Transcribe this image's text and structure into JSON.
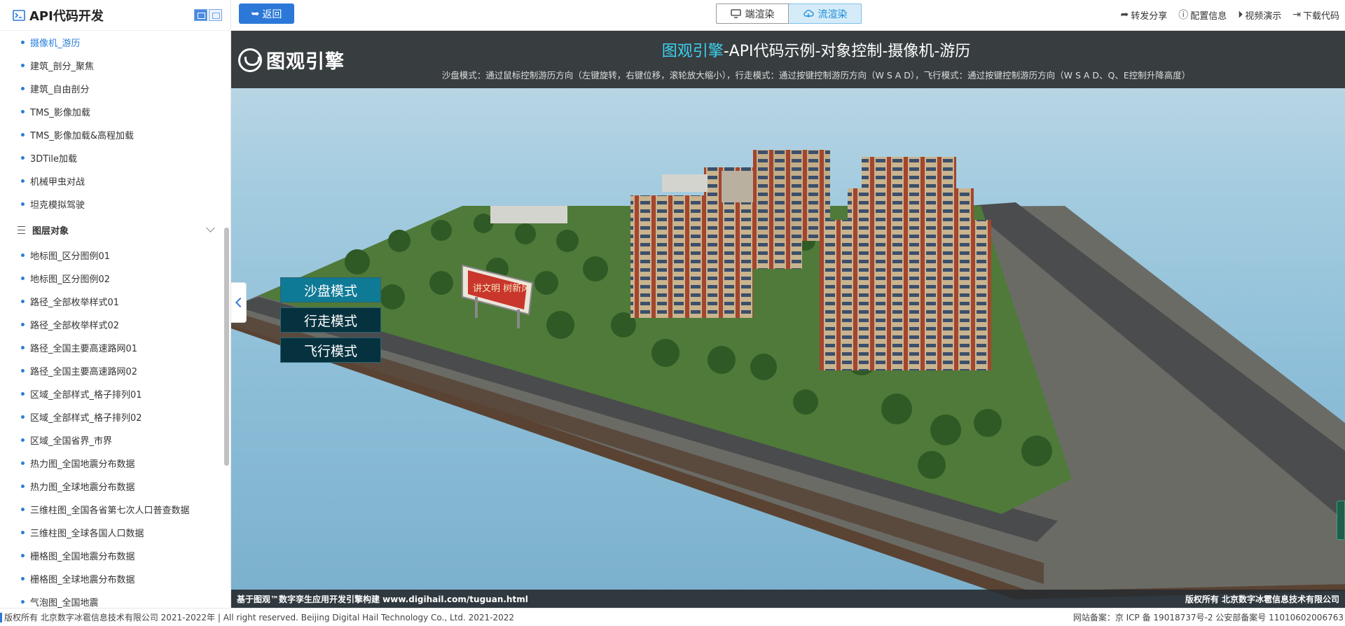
{
  "sidebar": {
    "title": "API代码开发",
    "items_top": [
      {
        "label": "摄像机_游历",
        "active": true
      },
      {
        "label": "建筑_剖分_聚焦"
      },
      {
        "label": "建筑_自由剖分"
      },
      {
        "label": "TMS_影像加载"
      },
      {
        "label": "TMS_影像加载&高程加载"
      },
      {
        "label": "3DTile加载"
      },
      {
        "label": "机械甲虫对战"
      },
      {
        "label": "坦克模拟驾驶"
      }
    ],
    "group_label": "图层对象",
    "items_group": [
      {
        "label": "地标图_区分图例01"
      },
      {
        "label": "地标图_区分图例02"
      },
      {
        "label": "路径_全部枚举样式01"
      },
      {
        "label": "路径_全部枚举样式02"
      },
      {
        "label": "路径_全国主要高速路网01"
      },
      {
        "label": "路径_全国主要高速路网02"
      },
      {
        "label": "区域_全部样式_格子排列01"
      },
      {
        "label": "区域_全部样式_格子排列02"
      },
      {
        "label": "区域_全国省界_市界"
      },
      {
        "label": "热力图_全国地震分布数据"
      },
      {
        "label": "热力图_全球地震分布数据"
      },
      {
        "label": "三维柱图_全国各省第七次人口普查数据"
      },
      {
        "label": "三维柱图_全球各国人口数据"
      },
      {
        "label": "栅格图_全国地震分布数据"
      },
      {
        "label": "栅格图_全球地震分布数据"
      },
      {
        "label": "气泡图_全国地震"
      }
    ]
  },
  "topbar": {
    "back_label": "返回",
    "client_render": "端渲染",
    "stream_render": "流渲染",
    "links": {
      "share": "转发分享",
      "config": "配置信息",
      "video": "视频演示",
      "download": "下载代码"
    }
  },
  "viewport": {
    "logo_text": "图观引擎",
    "title_brand": "图观引擎",
    "title_rest": "-API代码示例-对象控制-摄像机-游历",
    "subtitle": "沙盘模式：通过鼠标控制游历方向（左键旋转，右键位移，滚轮放大缩小），行走模式：通过按键控制游历方向（W S A D），飞行模式：通过按键控制游历方向（W S A D、Q、E控制升降高度）",
    "modes": [
      "沙盘模式",
      "行走模式",
      "飞行模式"
    ],
    "active_mode": "沙盘模式",
    "footer_left": "基于图观™数字孪生应用开发引擎构建 www.digihail.com/tuguan.html",
    "footer_right": "版权所有 北京数字冰雹信息技术有限公司",
    "billboard_text": "讲文明 树新风"
  },
  "footer": {
    "left": "版权所有 北京数字冰雹信息技术有限公司 2021-2022年 | All right reserved. Beijing Digital Hail Technology Co., Ltd. 2021-2022",
    "right": "网站备案：京 ICP 备 19018737号-2 公安部备案号 11010602006763"
  },
  "colors": {
    "accent": "#2b78d8",
    "brand_cyan": "#3cd3f0",
    "mode_active": "#0f7a95",
    "mode_idle": "#06323f"
  }
}
